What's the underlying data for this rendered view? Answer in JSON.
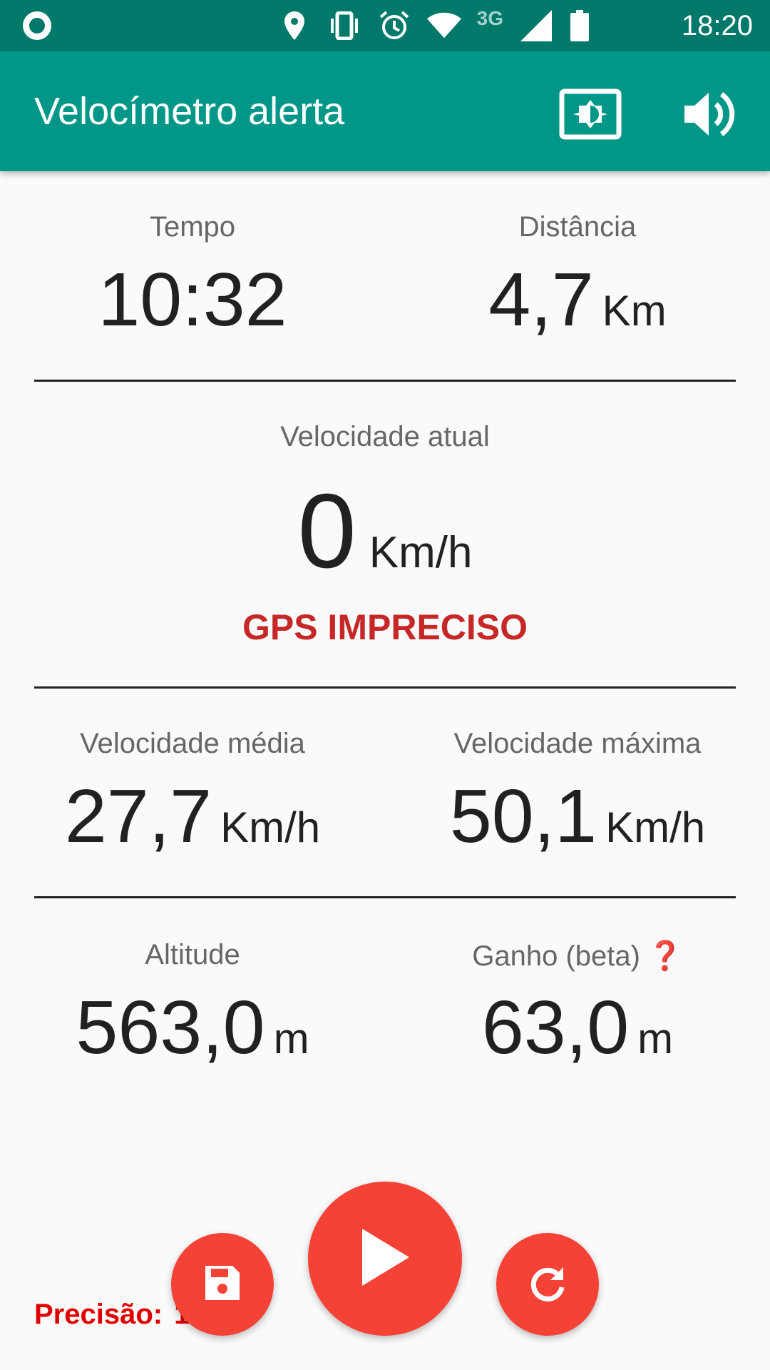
{
  "status_bar": {
    "time": "18:20",
    "network_label": "3G",
    "icons": [
      "notification-dot-icon",
      "location-icon",
      "vibrate-icon",
      "alarm-icon",
      "wifi-icon",
      "signal-icon",
      "battery-icon"
    ]
  },
  "app_bar": {
    "title": "Velocímetro alerta",
    "actions": [
      "brightness-icon",
      "volume-icon"
    ],
    "color": "#009688"
  },
  "stats": {
    "tempo": {
      "label": "Tempo",
      "value": "10:32"
    },
    "distancia": {
      "label": "Distância",
      "value": "4,7",
      "unit": "Km"
    },
    "velocidade_atual": {
      "label": "Velocidade atual",
      "value": "0",
      "unit": "Km/h",
      "warning": "GPS IMPRECISO"
    },
    "velocidade_media": {
      "label": "Velocidade média",
      "value": "27,7",
      "unit": "Km/h"
    },
    "velocidade_maxima": {
      "label": "Velocidade máxima",
      "value": "50,1",
      "unit": "Km/h"
    },
    "altitude": {
      "label": "Altitude",
      "value": "563,0",
      "unit": "m"
    },
    "ganho": {
      "label": "Ganho (beta)",
      "value": "63,0",
      "unit": "m",
      "help_icon": "❓"
    }
  },
  "bottom": {
    "precision_label": "Precisão:",
    "precision_value": "1…",
    "buttons": [
      "save-icon",
      "play-icon",
      "reset-icon"
    ],
    "fab_color": "#f44336"
  }
}
